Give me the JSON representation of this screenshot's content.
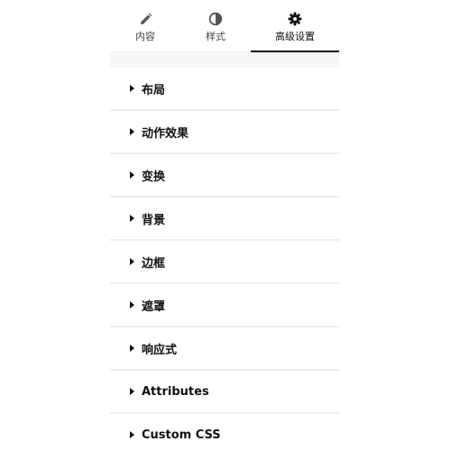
{
  "tabs": [
    {
      "label": "内容",
      "icon": "pencil-icon",
      "active": false
    },
    {
      "label": "样式",
      "icon": "contrast-icon",
      "active": false
    },
    {
      "label": "高级设置",
      "icon": "gear-icon",
      "active": true
    }
  ],
  "sections": [
    {
      "label": "布局"
    },
    {
      "label": "动作效果"
    },
    {
      "label": "变换"
    },
    {
      "label": "背景"
    },
    {
      "label": "边框"
    },
    {
      "label": "遮罩"
    },
    {
      "label": "响应式"
    },
    {
      "label": "Attributes"
    },
    {
      "label": "Custom CSS"
    }
  ],
  "colors": {
    "active_indicator": "#111111",
    "divider": "#eceded",
    "gap_background": "#f5f6f7"
  }
}
